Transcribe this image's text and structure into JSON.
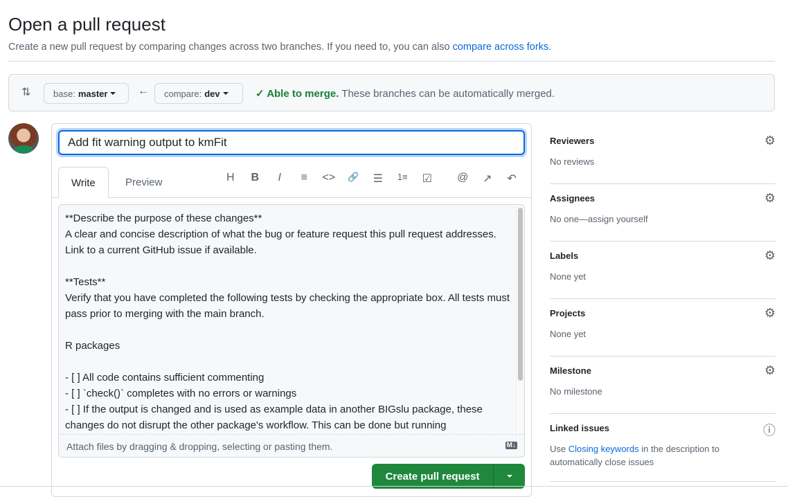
{
  "header": {
    "title": "Open a pull request",
    "subtitle": "Create a new pull request by comparing changes across two branches. If you need to, you can also ",
    "subtitle_link": "compare across forks",
    "subtitle_end": "."
  },
  "range": {
    "base_label": "base:",
    "base_value": "master",
    "compare_label": "compare:",
    "compare_value": "dev",
    "merge_status": "Able to merge.",
    "merge_text": "These branches can be automatically merged."
  },
  "form": {
    "title_value": "Add fit warning output to kmFit",
    "tabs": [
      "Write",
      "Preview"
    ],
    "toolbar": [
      "H",
      "B",
      "I",
      "≡",
      "<>",
      "🔗",
      "☰",
      "1≡",
      "☑",
      "@",
      "↗",
      "↶"
    ],
    "body": "**Describe the purpose of these changes**\nA clear and concise description of what the bug or feature request this pull request addresses. Link to a current GitHub issue if available.\n\n**Tests**\nVerify that you have completed the following tests by checking the appropriate box. All tests must pass prior to merging with the main branch.\n\nR packages\n\n- [ ] All code contains sufficient commenting\n- [ ] `check()` completes with no errors or warnings\n- [ ] If the output is changed and is used as example data in another BIGslu package, these changes do not disrupt the other package's workflow. This can be done but running",
    "attach": "Attach files by dragging & dropping, selecting or pasting them.",
    "md_badge": "M↓",
    "submit": "Create pull request"
  },
  "sidebar": [
    {
      "heading": "Reviewers",
      "value": "No reviews"
    },
    {
      "heading": "Assignees",
      "value": "No one—assign yourself"
    },
    {
      "heading": "Labels",
      "value": "None yet"
    },
    {
      "heading": "Projects",
      "value": "None yet"
    },
    {
      "heading": "Milestone",
      "value": "No milestone"
    },
    {
      "heading": "Linked issues",
      "value_pre": "Use ",
      "value_link": "Closing keywords",
      "value_post": " in the description to automatically close issues"
    }
  ]
}
